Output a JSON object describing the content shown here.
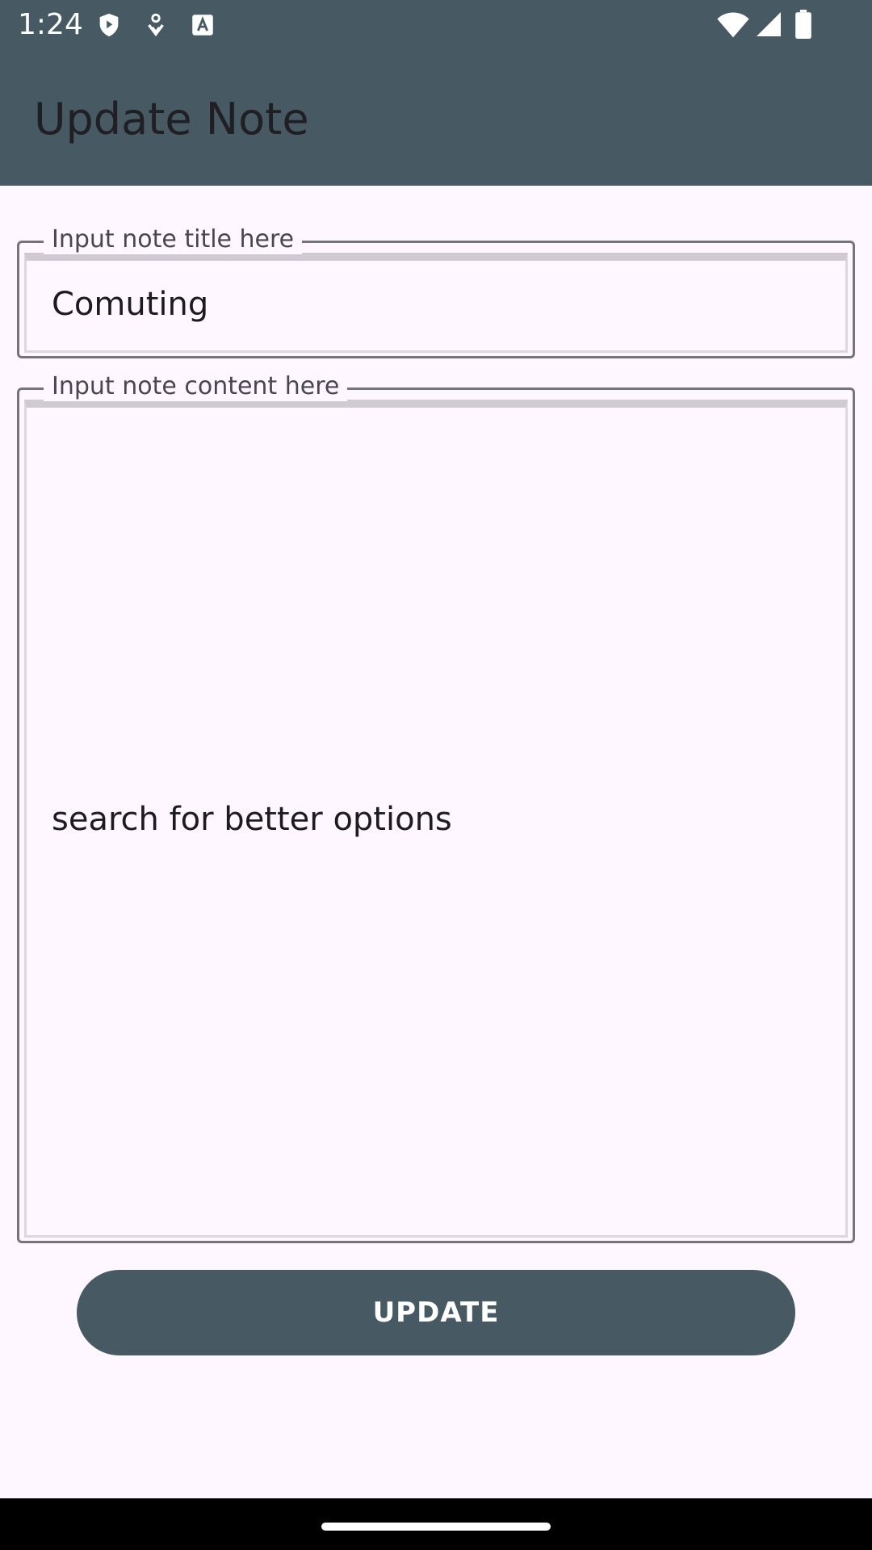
{
  "status_bar": {
    "time": "1:24",
    "icons": [
      "shield-icon",
      "download-icon",
      "font-icon",
      "wifi-icon",
      "signal-icon",
      "battery-icon"
    ]
  },
  "app_bar": {
    "title": "Update Note"
  },
  "form": {
    "title_field": {
      "legend": "Input note title here",
      "value": "Comuting"
    },
    "content_field": {
      "legend": "Input note content here",
      "value": "search for better options"
    },
    "update_label": "UPDATE"
  },
  "colors": {
    "primary": "#475A64",
    "background": "#FEF7FF",
    "outline": "#77737C",
    "on_primary": "#FFFFFF"
  }
}
